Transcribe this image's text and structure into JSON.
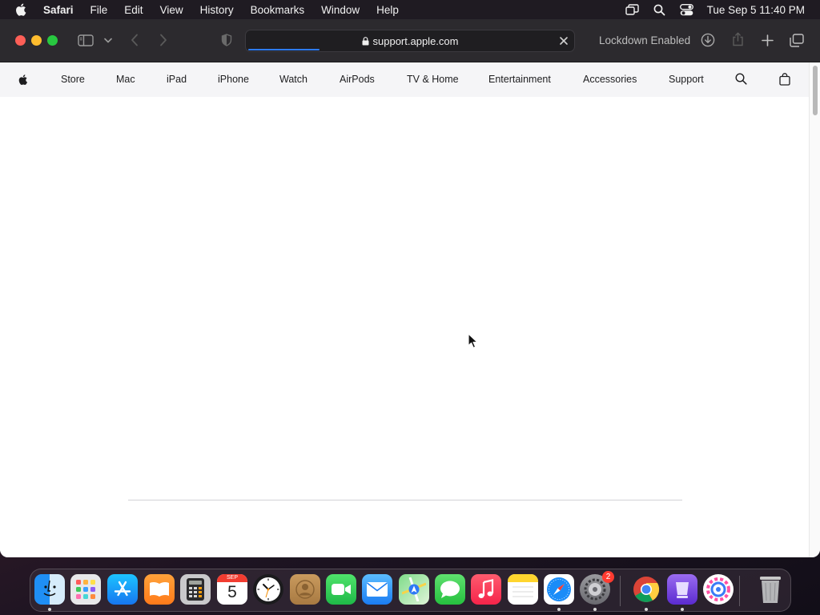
{
  "menubar": {
    "app_name": "Safari",
    "items": [
      "File",
      "Edit",
      "View",
      "History",
      "Bookmarks",
      "Window",
      "Help"
    ],
    "clock": "Tue Sep 5  11:40 PM"
  },
  "toolbar": {
    "url": "support.apple.com",
    "lockdown_label": "Lockdown Enabled",
    "load_progress": 0.22
  },
  "nav": {
    "items": [
      "Store",
      "Mac",
      "iPad",
      "iPhone",
      "Watch",
      "AirPods",
      "TV & Home",
      "Entertainment",
      "Accessories",
      "Support"
    ]
  },
  "dock": {
    "calendar_month": "SEP",
    "calendar_day": "5",
    "settings_badge": "2",
    "apps": [
      "finder-icon",
      "launchpad-icon",
      "app-store-icon",
      "books-icon",
      "calculator-icon",
      "calendar-icon",
      "clock-icon",
      "contacts-icon",
      "facetime-icon",
      "mail-icon",
      "maps-icon",
      "messages-icon",
      "music-icon",
      "notes-icon",
      "safari-icon",
      "system-settings-icon",
      "chrome-icon",
      "app-icon",
      "app-icon",
      "trash-icon"
    ]
  },
  "colors": {
    "accent": "#2d7bf6",
    "close": "#fe5f57",
    "minimize": "#febc2e",
    "zoom": "#28c840"
  }
}
